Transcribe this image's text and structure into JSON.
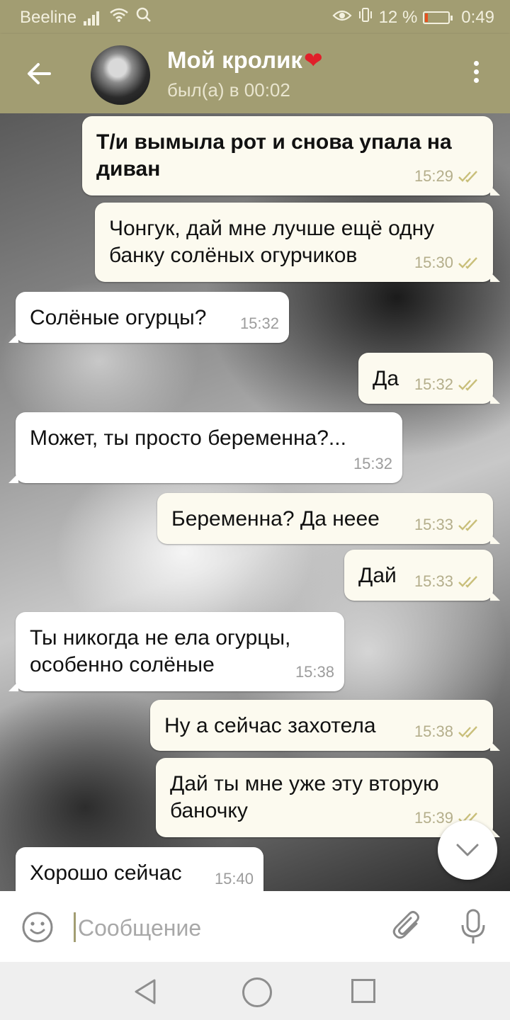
{
  "status_bar": {
    "carrier": "Beeline",
    "battery_percent": "12 %",
    "battery_level": 0.12,
    "time": "0:49"
  },
  "header": {
    "contact_name": "Мой кролик",
    "contact_status": "был(а) в 00:02"
  },
  "messages": [
    {
      "dir": "out",
      "text": "Т/и вымыла рот и снова упала на диван",
      "time": "15:29",
      "read": true
    },
    {
      "dir": "out",
      "text": "Чонгук, дай мне лучше ещё одну банку солёных огурчиков",
      "time": "15:30",
      "read": true
    },
    {
      "dir": "in",
      "text": "Солёные огурцы?",
      "time": "15:32"
    },
    {
      "dir": "out",
      "text": "Да",
      "time": "15:32",
      "read": true
    },
    {
      "dir": "in",
      "text": "Может, ты просто беременна?...",
      "time": "15:32"
    },
    {
      "dir": "out",
      "text": "Беременна? Да неее",
      "time": "15:33",
      "read": true
    },
    {
      "dir": "out",
      "text": "Дай",
      "time": "15:33",
      "read": true
    },
    {
      "dir": "in",
      "text": "Ты никогда не ела огурцы, особенно солёные",
      "time": "15:38"
    },
    {
      "dir": "out",
      "text": "Ну а сейчас захотела",
      "time": "15:38",
      "read": true
    },
    {
      "dir": "out",
      "text": "Дай ты мне уже эту вторую баночку",
      "time": "15:39",
      "read": true
    },
    {
      "dir": "in",
      "text": "Хорошо сейчас",
      "time": "15:40"
    }
  ],
  "input": {
    "placeholder": "Сообщение",
    "value": ""
  },
  "colors": {
    "accent": "#a29d72",
    "outgoing_bubble": "#fcfaef",
    "incoming_bubble": "#ffffff",
    "check_color": "#c9bf7a"
  }
}
